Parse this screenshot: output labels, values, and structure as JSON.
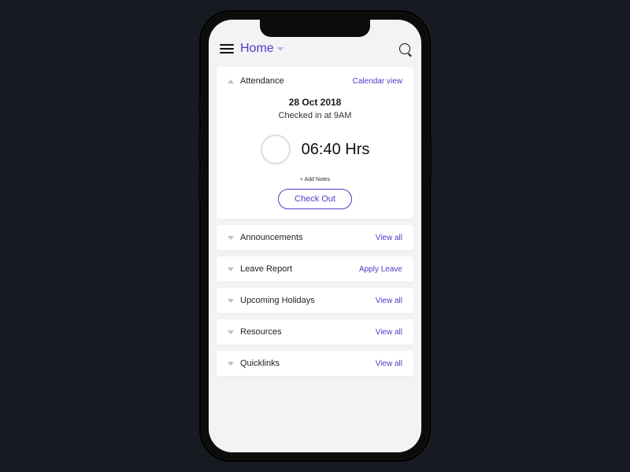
{
  "header": {
    "title": "Home"
  },
  "attendance": {
    "label": "Attendance",
    "calendar_link": "Calendar view",
    "date": "28 Oct 2018",
    "status": "Checked in at 9AM",
    "elapsed": "06:40 Hrs",
    "add_notes": "+ Add Notes",
    "checkout": "Check Out"
  },
  "sections": {
    "announcements": {
      "label": "Announcements",
      "action": "View all"
    },
    "leave": {
      "label": "Leave Report",
      "action": "Apply Leave"
    },
    "holidays": {
      "label": "Upcoming Holidays",
      "action": "View all"
    },
    "resources": {
      "label": "Resources",
      "action": "View all"
    },
    "quicklinks": {
      "label": "Quicklinks",
      "action": "View all"
    }
  }
}
